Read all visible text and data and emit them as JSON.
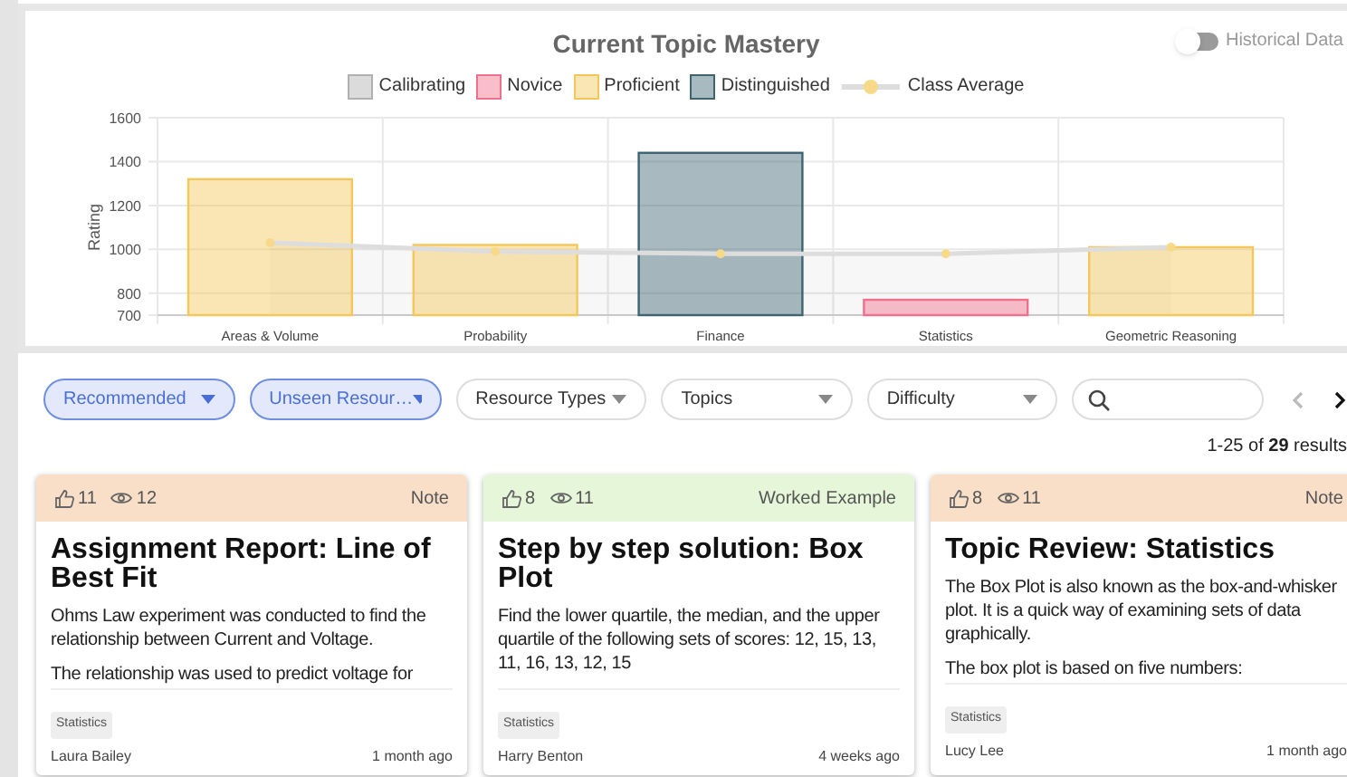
{
  "mastery": {
    "title": "Current Topic Mastery",
    "historical_toggle": {
      "label": "Historical Data",
      "on": false
    },
    "chart_data": {
      "type": "bar",
      "ylabel": "Rating",
      "categories": [
        "Areas & Volume",
        "Probability",
        "Finance",
        "Statistics",
        "Geometric Reasoning"
      ],
      "ylim": [
        700,
        1600
      ],
      "yticks": [
        700,
        800,
        1000,
        1200,
        1400,
        1600
      ],
      "grid": true,
      "series": [
        {
          "name": "Calibrating",
          "color": "#b0b0b0",
          "values": [
            null,
            null,
            null,
            null,
            null
          ]
        },
        {
          "name": "Novice",
          "color": "#f0708c",
          "values": [
            null,
            null,
            null,
            770,
            null
          ]
        },
        {
          "name": "Proficient",
          "color": "#f5c75a",
          "values": [
            1320,
            1020,
            null,
            null,
            1010
          ]
        },
        {
          "name": "Distinguished",
          "color": "#3d6470",
          "values": [
            null,
            null,
            1440,
            null,
            null
          ]
        },
        {
          "name": "Class Average",
          "type": "line",
          "marker": "circle",
          "color": "#f7d98a",
          "values": [
            1030,
            990,
            980,
            980,
            1010
          ]
        }
      ]
    }
  },
  "filters": [
    {
      "label": "Recommended",
      "selected": true
    },
    {
      "label": "Unseen Resour…",
      "selected": true
    },
    {
      "label": "Resource Types",
      "selected": false
    },
    {
      "label": "Topics",
      "selected": false
    },
    {
      "label": "Difficulty",
      "selected": false
    }
  ],
  "pagination": {
    "previous_disabled": true,
    "next_disabled": false,
    "summary": "1-25 of **29** results"
  },
  "cards": [
    {
      "kind": "note",
      "likes": "11",
      "views": "12",
      "type": "Note",
      "title": "Assignment Report: Line of Best Fit",
      "paragraphs": [
        "Ohms Law experiment was conducted to find the relationship between Current and Voltage.",
        "The relationship was used to predict voltage for"
      ],
      "tag": "Statistics",
      "author": "Laura Bailey",
      "time": "1 month ago"
    },
    {
      "kind": "worked_example",
      "likes": "8",
      "views": "11",
      "type": "Worked Example",
      "title": "Step by step solution: Box Plot",
      "paragraphs": [
        "Find the lower quartile, the median, and the upper quartile of the following sets of scores: 12, 15, 13, 11, 16, 13, 12, 15"
      ],
      "tag": "Statistics",
      "author": "Harry Benton",
      "time": "4 weeks ago"
    },
    {
      "kind": "note",
      "likes": "8",
      "views": "11",
      "type": "Note",
      "title": "Topic Review: Statistics",
      "paragraphs": [
        "The Box Plot is also known as the box-and-whisker plot. It is a quick way of examining sets of data graphically.",
        "The box plot is based on five numbers:"
      ],
      "tag": "Statistics",
      "author": "Lucy Lee",
      "time": "1 month ago"
    }
  ]
}
